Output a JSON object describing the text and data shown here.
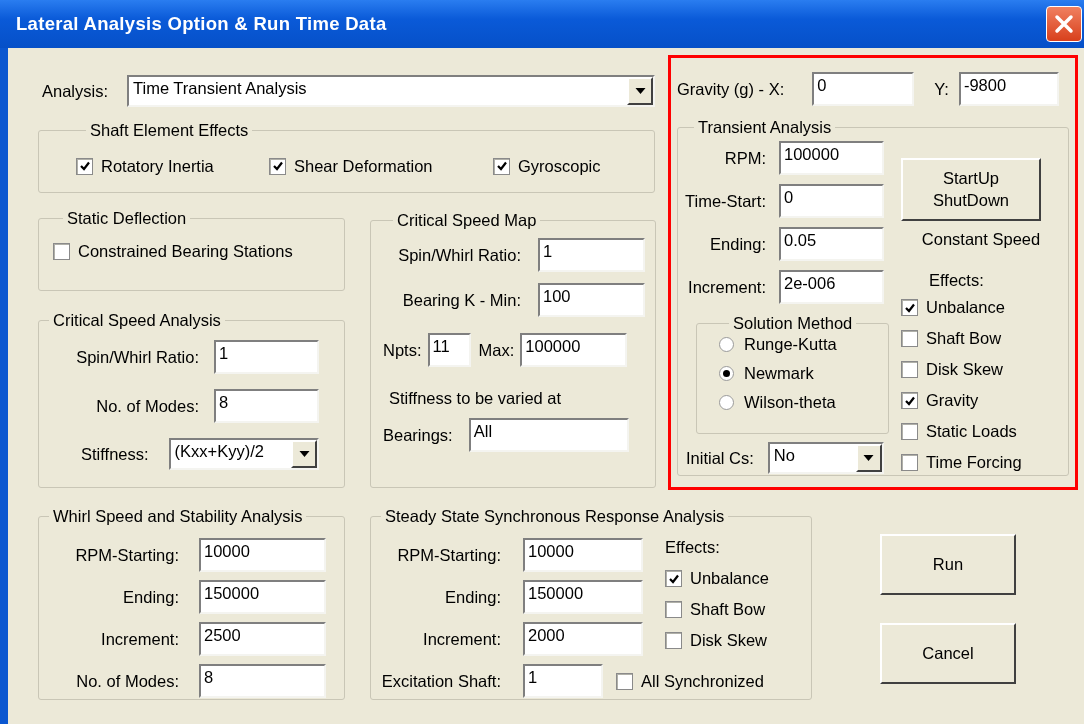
{
  "window": {
    "title": "Lateral Analysis Option & Run Time Data"
  },
  "analysis": {
    "label": "Analysis:",
    "value": "Time Transient Analysis"
  },
  "shaft_element_effects": {
    "title": "Shaft Element Effects",
    "options": [
      {
        "label": "Rotatory Inertia",
        "checked": true
      },
      {
        "label": "Shear Deformation",
        "checked": true
      },
      {
        "label": "Gyroscopic",
        "checked": true
      }
    ]
  },
  "static_deflection": {
    "title": "Static Deflection",
    "options": [
      {
        "label": "Constrained Bearing Stations",
        "checked": false
      }
    ]
  },
  "critical_speed_analysis": {
    "title": "Critical Speed Analysis",
    "fields": [
      {
        "label": "Spin/Whirl Ratio:",
        "value": "1"
      },
      {
        "label": "No. of Modes:",
        "value": "8"
      }
    ],
    "stiffness": {
      "label": "Stiffness:",
      "value": "(Kxx+Kyy)/2"
    }
  },
  "critical_speed_map": {
    "title": "Critical Speed Map",
    "fields": [
      {
        "label": "Spin/Whirl Ratio:",
        "value": "1"
      },
      {
        "label": "Bearing K - Min:",
        "value": "100"
      }
    ],
    "npts": {
      "label": "Npts:",
      "value": "11"
    },
    "max": {
      "label": "Max:",
      "value": "100000"
    },
    "note": "Stiffness to be varied at",
    "bearings": {
      "label": "Bearings:",
      "value": "All"
    }
  },
  "gravity": {
    "x_label": "Gravity (g) - X:",
    "x_value": "0",
    "y_label": "Y:",
    "y_value": "-9800"
  },
  "transient_analysis": {
    "title": "Transient Analysis",
    "fields": [
      {
        "label": "RPM:",
        "value": "100000"
      },
      {
        "label": "Time-Start:",
        "value": "0"
      },
      {
        "label": "Ending:",
        "value": "0.05"
      },
      {
        "label": "Increment:",
        "value": "2e-006"
      }
    ],
    "startup_button": "StartUp ShutDown",
    "speed_mode": "Constant Speed",
    "effects_label": "Effects:",
    "effects": [
      {
        "label": "Unbalance",
        "checked": true
      },
      {
        "label": "Shaft Bow",
        "checked": false
      },
      {
        "label": "Disk Skew",
        "checked": false
      },
      {
        "label": "Gravity",
        "checked": true
      },
      {
        "label": "Static Loads",
        "checked": false
      },
      {
        "label": "Time Forcing",
        "checked": false
      }
    ],
    "solution_method": {
      "title": "Solution Method",
      "options": [
        {
          "label": "Runge-Kutta",
          "selected": false
        },
        {
          "label": "Newmark",
          "selected": true
        },
        {
          "label": "Wilson-theta",
          "selected": false
        }
      ]
    },
    "initial_cs": {
      "label": "Initial Cs:",
      "value": "No"
    }
  },
  "whirl_speed_stability": {
    "title": "Whirl Speed and Stability Analysis",
    "fields": [
      {
        "label": "RPM-Starting:",
        "value": "10000"
      },
      {
        "label": "Ending:",
        "value": "150000"
      },
      {
        "label": "Increment:",
        "value": "2500"
      },
      {
        "label": "No. of Modes:",
        "value": "8"
      }
    ]
  },
  "steady_state_response": {
    "title": "Steady State Synchronous Response Analysis",
    "fields": [
      {
        "label": "RPM-Starting:",
        "value": "10000"
      },
      {
        "label": "Ending:",
        "value": "150000"
      },
      {
        "label": "Increment:",
        "value": "2000"
      }
    ],
    "excitation_shaft": {
      "label": "Excitation Shaft:",
      "value": "1"
    },
    "effects_label": "Effects:",
    "effects": [
      {
        "label": "Unbalance",
        "checked": true
      },
      {
        "label": "Shaft Bow",
        "checked": false
      },
      {
        "label": "Disk Skew",
        "checked": false
      }
    ],
    "all_synchronized": {
      "label": "All Synchronized",
      "checked": false
    }
  },
  "buttons": [
    "Run",
    "Cancel"
  ]
}
